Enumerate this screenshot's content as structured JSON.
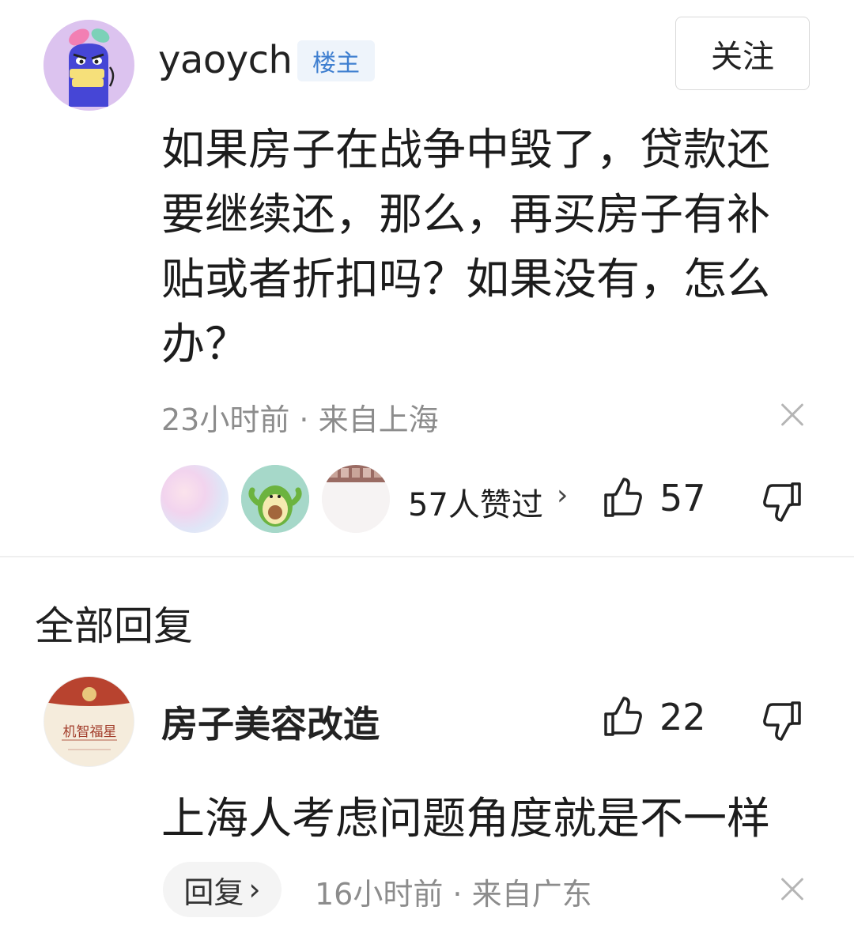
{
  "post": {
    "author": "yaoych",
    "badge": "楼主",
    "follow_label": "关注",
    "text": "如果房子在战争中毁了，贷款还要继续还，那么，再买房子有补贴或者折扣吗？如果没有，怎么办？",
    "meta": "23小时前 · 来自上海",
    "likers_label": "57人赞过",
    "likers_chevron": "›",
    "like_count": "57"
  },
  "replies": {
    "title": "全部回复",
    "items": [
      {
        "author": "房子美容改造",
        "like_count": "22",
        "text": "上海人考虑问题角度就是不一样",
        "reply_label": "回复",
        "reply_chevron": "›",
        "meta": "16小时前 · 来自广东",
        "avatar_text": "机智福星"
      }
    ]
  },
  "icons": {
    "like": "thumbs-up-icon",
    "dislike": "thumbs-down-icon",
    "close": "close-icon",
    "chevron": "chevron-right-icon"
  },
  "colors": {
    "badge_text": "#3f7fd0",
    "badge_bg": "#eef4fb",
    "meta_text": "#8c8c8c"
  }
}
